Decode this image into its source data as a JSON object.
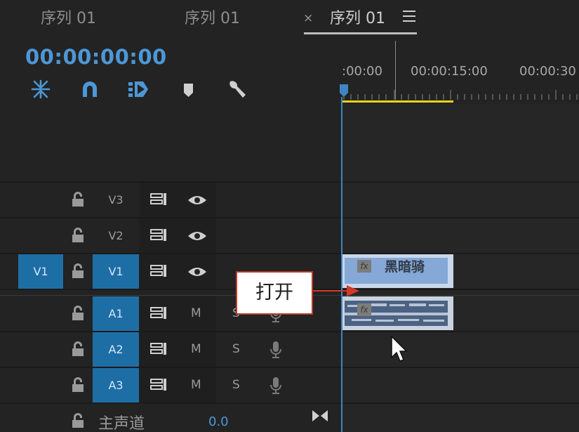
{
  "tabs": [
    {
      "label": "序列 01"
    },
    {
      "label": "序列 01"
    },
    {
      "label": "序列 01",
      "close": "×"
    }
  ],
  "timecode": "00:00:00:00",
  "ruler": {
    "labels": [
      ":00:00",
      "00:00:15:00",
      "00:00:30"
    ]
  },
  "tools": [
    "snap-icon",
    "linked-selection-icon",
    "add-marker-icon",
    "marker-icon",
    "wrench-icon"
  ],
  "tracks": {
    "video": [
      {
        "name": "V3",
        "source": ""
      },
      {
        "name": "V2",
        "source": ""
      },
      {
        "name": "V1",
        "source": "V1"
      }
    ],
    "audio": [
      {
        "name": "A1",
        "m": "M",
        "s": "S"
      },
      {
        "name": "A2",
        "m": "M",
        "s": "S"
      },
      {
        "name": "A3",
        "m": "M",
        "s": "S"
      }
    ]
  },
  "master": {
    "label": "主声道",
    "value": "0.0"
  },
  "clips": {
    "video": {
      "fx": "fx",
      "title": "黑暗骑"
    },
    "audio": {
      "fx": "fx"
    }
  },
  "callout": {
    "text": "打开"
  },
  "colors": {
    "accent": "#4d97d7",
    "patch": "#1e6ea6",
    "work_area": "#e8d21b",
    "callout_border": "#c0392b"
  }
}
